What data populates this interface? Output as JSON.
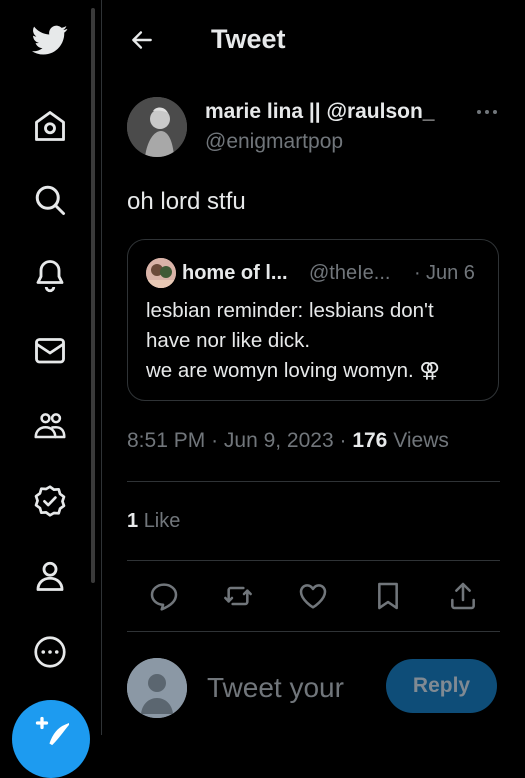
{
  "header": {
    "title": "Tweet"
  },
  "tweet": {
    "author_name": "marie lina || @raulson_",
    "author_handle": "@enigmartpop",
    "text": "oh lord stfu",
    "time": "8:51 PM",
    "date": "Jun 9, 2023",
    "views_count": "176",
    "views_label": "Views",
    "likes_count": "1",
    "likes_label": "Like"
  },
  "quote": {
    "author_name": "home of l...",
    "author_handle": "@theIe...",
    "date": "Jun 6",
    "lines": [
      "lesbian reminder: lesbians don't",
      "have nor like dick.",
      "we are womyn loving womyn. ⚢"
    ]
  },
  "reply": {
    "placeholder": "Tweet your",
    "button_label": "Reply"
  },
  "icons": {
    "sidebar": [
      "twitter-logo",
      "home-icon",
      "search-icon",
      "bell-icon",
      "mail-icon",
      "communities-icon",
      "verified-icon",
      "profile-icon",
      "more-circle-icon",
      "compose-icon"
    ],
    "actions": [
      "reply-icon",
      "retweet-icon",
      "like-icon",
      "bookmark-icon",
      "share-icon"
    ]
  },
  "colors": {
    "background": "#000000",
    "text": "#e7e9ea",
    "muted": "#71767b",
    "accent": "#1d9bf0",
    "border": "#2f3336"
  }
}
